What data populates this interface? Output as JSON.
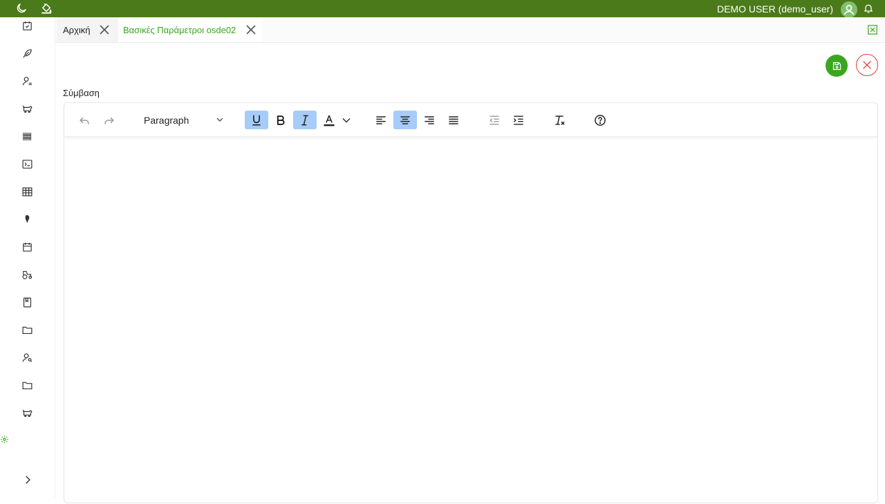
{
  "topbar": {
    "user_label": "DEMO USER (demo_user)",
    "icons": [
      "moon-icon",
      "paint-bucket-icon",
      "user-avatar-icon",
      "bell-icon"
    ],
    "color": "#4a7a1a"
  },
  "sidebar": {
    "icons": [
      "calendar-check-icon",
      "feather-icon",
      "user-settings-icon",
      "cow-icon",
      "barcode-icon",
      "terminal-icon",
      "table-icon",
      "location-icon",
      "calendar-icon",
      "tractor-icon",
      "book-icon",
      "folder-icon",
      "user-search-icon",
      "folder-icon",
      "cow-icon"
    ],
    "bottom_icons": [
      "gear-icon",
      "chevron-right-icon"
    ]
  },
  "tabs": [
    {
      "label": "Αρχική",
      "active": false
    },
    {
      "label": "Βασικές Παράμετροι osde02",
      "active": true
    }
  ],
  "form": {
    "field_label": "Σύμβαση"
  },
  "editor": {
    "block_format": "Paragraph",
    "toolbar_buttons": [
      "undo",
      "redo",
      "underline",
      "bold",
      "italic",
      "text-color",
      "align-left",
      "align-center",
      "align-right",
      "justify",
      "outdent",
      "indent",
      "clear-formatting",
      "help"
    ],
    "active_buttons": [
      "underline",
      "italic",
      "align-center"
    ],
    "content": ""
  },
  "colors": {
    "accent": "#3aa61f",
    "danger": "#e53935",
    "toolbar_active": "#a6ccf7"
  }
}
